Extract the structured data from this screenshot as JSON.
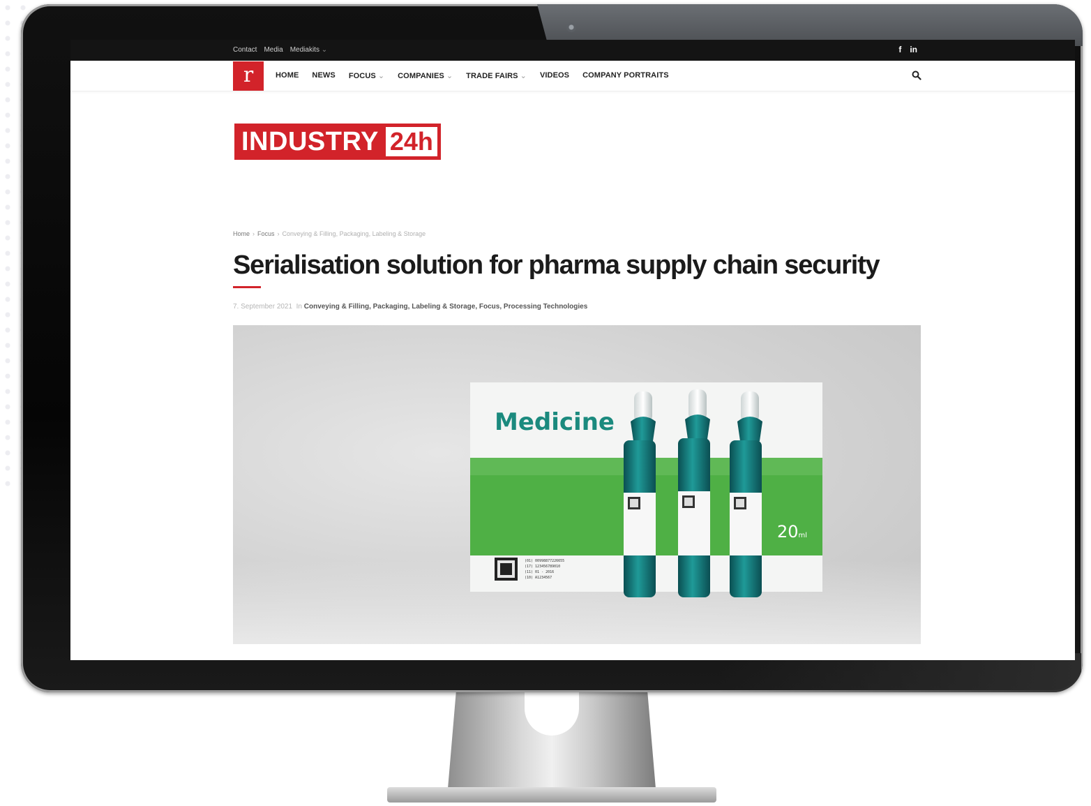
{
  "topbar": {
    "links": [
      "Contact",
      "Media",
      "Mediakits"
    ],
    "mediakits_caret": "⌄",
    "social": [
      "f",
      "in"
    ]
  },
  "nav": {
    "logo_letter": "r",
    "items": [
      {
        "label": "HOME",
        "caret": ""
      },
      {
        "label": "NEWS",
        "caret": ""
      },
      {
        "label": "FOCUS",
        "caret": "⌄"
      },
      {
        "label": "COMPANIES",
        "caret": "⌄"
      },
      {
        "label": "TRADE FAIRS",
        "caret": "⌄"
      },
      {
        "label": "VIDEOS",
        "caret": ""
      },
      {
        "label": "COMPANY PORTRAITS",
        "caret": ""
      }
    ],
    "search_icon": "search-icon"
  },
  "brand": {
    "part1": "INDUSTRY",
    "part2": "24h",
    "color": "#d2232a"
  },
  "breadcrumb": {
    "items": [
      "Home",
      "Focus",
      "Conveying & Filling, Packaging, Labeling & Storage"
    ],
    "separator": "›"
  },
  "article": {
    "title": "Serialisation solution for pharma supply chain security",
    "date": "7. September 2021",
    "in_label": "In",
    "categories": "Conveying & Filling, Packaging, Labeling & Storage, Focus, Processing Technologies"
  },
  "hero_image": {
    "box_label": "Medicine",
    "volume": "20",
    "volume_unit": "ml",
    "box_code_lines": [
      "(01) 00998877226655",
      "(17) 123456789010",
      "(11) 01 - 2016",
      "(10) A1234567"
    ]
  },
  "colors": {
    "accent": "#d2232a",
    "box_green": "#4fb045",
    "box_text": "#1b8a7e",
    "vial": "#137878"
  }
}
